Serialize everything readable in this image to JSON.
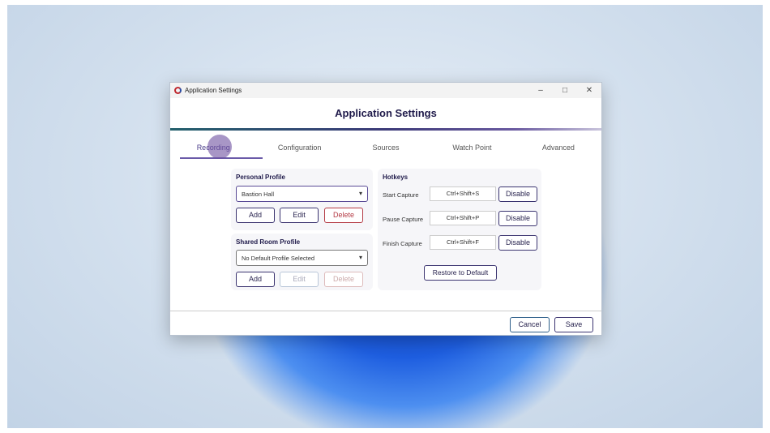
{
  "window": {
    "titlebar": "Application Settings",
    "header": "Application Settings",
    "minimize": "–",
    "maximize": "□",
    "close": "✕"
  },
  "tabs": [
    {
      "label": "Recording"
    },
    {
      "label": "Configuration"
    },
    {
      "label": "Sources"
    },
    {
      "label": "Watch Point"
    },
    {
      "label": "Advanced"
    }
  ],
  "personal": {
    "title": "Personal Profile",
    "selected": "Bastion Hall",
    "add": "Add",
    "edit": "Edit",
    "delete": "Delete"
  },
  "shared": {
    "title": "Shared Room Profile",
    "selected": "No Default Profile Selected",
    "add": "Add",
    "edit": "Edit",
    "delete": "Delete"
  },
  "hotkeys": {
    "title": "Hotkeys",
    "rows": [
      {
        "label": "Start Capture",
        "value": "Ctrl+Shift+S",
        "button": "Disable"
      },
      {
        "label": "Pause Capture",
        "value": "Ctrl+Shift+P",
        "button": "Disable"
      },
      {
        "label": "Finish Capture",
        "value": "Ctrl+Shift+F",
        "button": "Disable"
      }
    ],
    "restore": "Restore to Default"
  },
  "footer": {
    "cancel": "Cancel",
    "save": "Save"
  }
}
